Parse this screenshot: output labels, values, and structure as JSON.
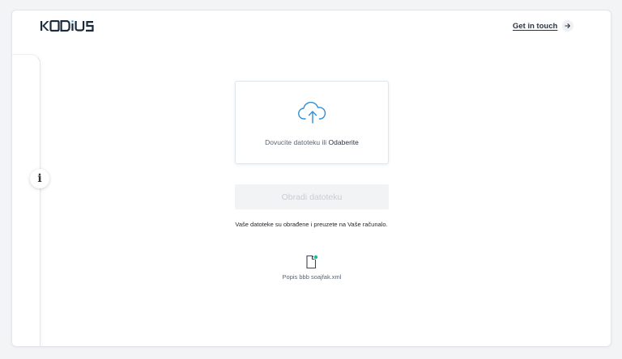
{
  "header": {
    "logo_text": "KODIUS",
    "cta_label": "Get in touch"
  },
  "sidebar": {
    "info_label": "i"
  },
  "upload": {
    "prompt": "Dovucite datoteku ili",
    "browse_label": "Odaberite"
  },
  "actions": {
    "process_label": "Obradi datoteku"
  },
  "notice": "Vaše datoteke su obrađene i preuzete na Vaše računalo.",
  "files": [
    {
      "name": "Popis bbb soajfak.xml",
      "status_color": "#1fb89a"
    }
  ],
  "colors": {
    "accent": "#2f8fd1",
    "logo_dark": "#1b2a3a",
    "logo_accent": "#29a3e0",
    "status": "#1fb89a"
  },
  "icons": {
    "upload": "cloud-upload-icon",
    "arrow": "arrow-right-icon",
    "file": "file-icon"
  }
}
